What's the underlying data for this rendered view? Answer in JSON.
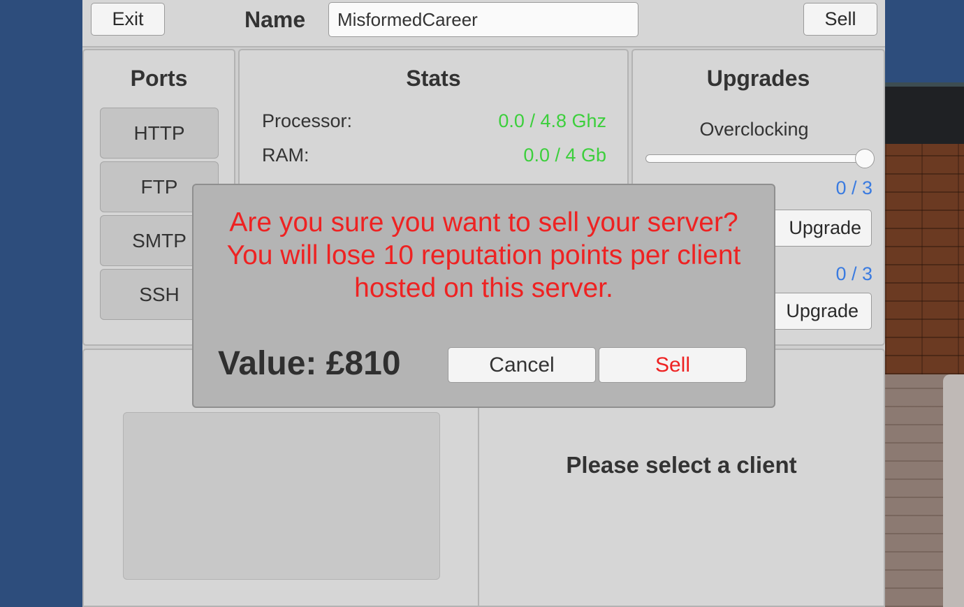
{
  "header": {
    "exit_label": "Exit",
    "name_label": "Name",
    "name_value": "MisformedCareer",
    "sell_label": "Sell"
  },
  "ports": {
    "title": "Ports",
    "items": [
      "HTTP",
      "FTP",
      "SMTP",
      "SSH"
    ]
  },
  "stats": {
    "title": "Stats",
    "rows": [
      {
        "label": "Processor:",
        "value": "0.0 / 4.8 Ghz"
      },
      {
        "label": "RAM:",
        "value": "0.0 / 4 Gb"
      }
    ],
    "value_color": "#3ccf3c"
  },
  "upgrades": {
    "title": "Upgrades",
    "overclocking_label": "Overclocking",
    "overclocking_level": 1.0,
    "items": [
      {
        "count": "0 / 3",
        "button": "Upgrade"
      },
      {
        "count": "0 / 3",
        "button": "Upgrade"
      }
    ],
    "count_color": "#3a7be0"
  },
  "client": {
    "message": "Please select a client"
  },
  "modal": {
    "message": "Are you sure you want to sell your server? You will lose 10 reputation points per client hosted on this server.",
    "value": "Value: £810",
    "cancel_label": "Cancel",
    "sell_label": "Sell",
    "message_color": "#ee2222"
  }
}
